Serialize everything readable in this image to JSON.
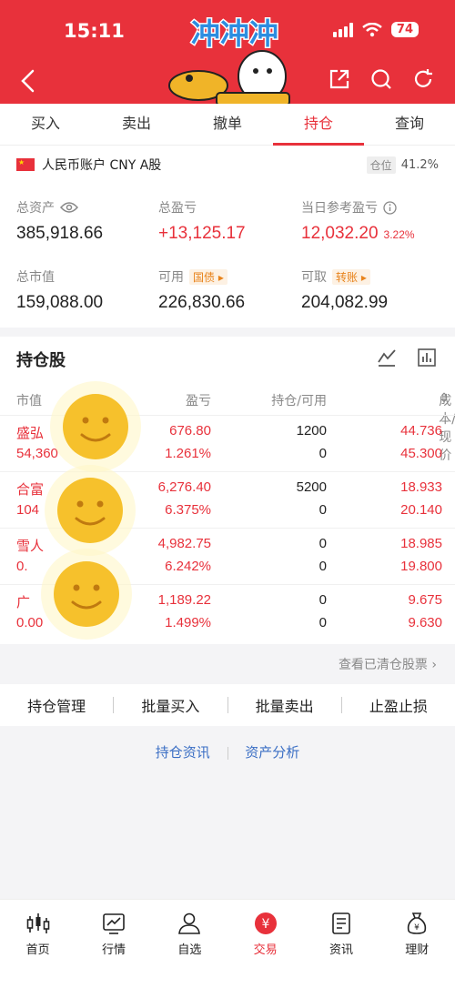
{
  "status": {
    "time": "15:11",
    "battery": "74"
  },
  "header": {
    "sticker_text": "冲冲冲"
  },
  "tabs": [
    {
      "label": "买入"
    },
    {
      "label": "卖出"
    },
    {
      "label": "撤单"
    },
    {
      "label": "持仓",
      "active": true
    },
    {
      "label": "查询"
    }
  ],
  "account": {
    "label": "人民币账户 CNY A股",
    "position_tag": "仓位",
    "position_value": "41.2%",
    "total_assets_label": "总资产",
    "total_assets": "385,918.66",
    "total_pl_label": "总盈亏",
    "total_pl": "+13,125.17",
    "today_pl_label": "当日参考盈亏",
    "today_pl": "12,032.20",
    "today_pl_pct": "3.22%",
    "market_value_label": "总市值",
    "market_value": "159,088.00",
    "available_label": "可用",
    "available_tag": "国债",
    "available": "226,830.66",
    "withdrawable_label": "可取",
    "withdrawable_tag": "转账",
    "withdrawable": "204,082.99"
  },
  "holdings": {
    "title": "持仓股",
    "headers": {
      "market_value": "市值",
      "pl": "盈亏",
      "position": "持仓/可用",
      "cost": "成本/现价"
    },
    "rows": [
      {
        "name": "盛弘",
        "mv": "54,360",
        "pl": "676.80",
        "pl_pct": "1.261%",
        "pos": "1200",
        "avail": "0",
        "cost": "44.736",
        "price": "45.300"
      },
      {
        "name": "合富",
        "mv": "104",
        "pl": "6,276.40",
        "pl_pct": "6.375%",
        "pos": "5200",
        "avail": "0",
        "cost": "18.933",
        "price": "20.140"
      },
      {
        "name": "雪人",
        "mv": "0.",
        "pl": "4,982.75",
        "pl_pct": "6.242%",
        "pos": "0",
        "avail": "0",
        "cost": "18.985",
        "price": "19.800"
      },
      {
        "name": "广",
        "mv": "0.00",
        "pl": "1,189.22",
        "pl_pct": "1.499%",
        "pos": "0",
        "avail": "0",
        "cost": "9.675",
        "price": "9.630"
      }
    ],
    "cleared_link": "查看已清仓股票 ›"
  },
  "actions": [
    "持仓管理",
    "批量买入",
    "批量卖出",
    "止盈止损"
  ],
  "links": [
    "持仓资讯",
    "资产分析"
  ],
  "bottom_nav": [
    {
      "label": "首页",
      "icon": "candlestick-icon"
    },
    {
      "label": "行情",
      "icon": "chart-icon"
    },
    {
      "label": "自选",
      "icon": "user-icon"
    },
    {
      "label": "交易",
      "icon": "yuan-icon",
      "active": true
    },
    {
      "label": "资讯",
      "icon": "news-icon"
    },
    {
      "label": "理财",
      "icon": "moneybag-icon"
    }
  ],
  "colors": {
    "brand_red": "#e8313b",
    "link_blue": "#3a6ec4",
    "tag_orange": "#e8831b"
  }
}
